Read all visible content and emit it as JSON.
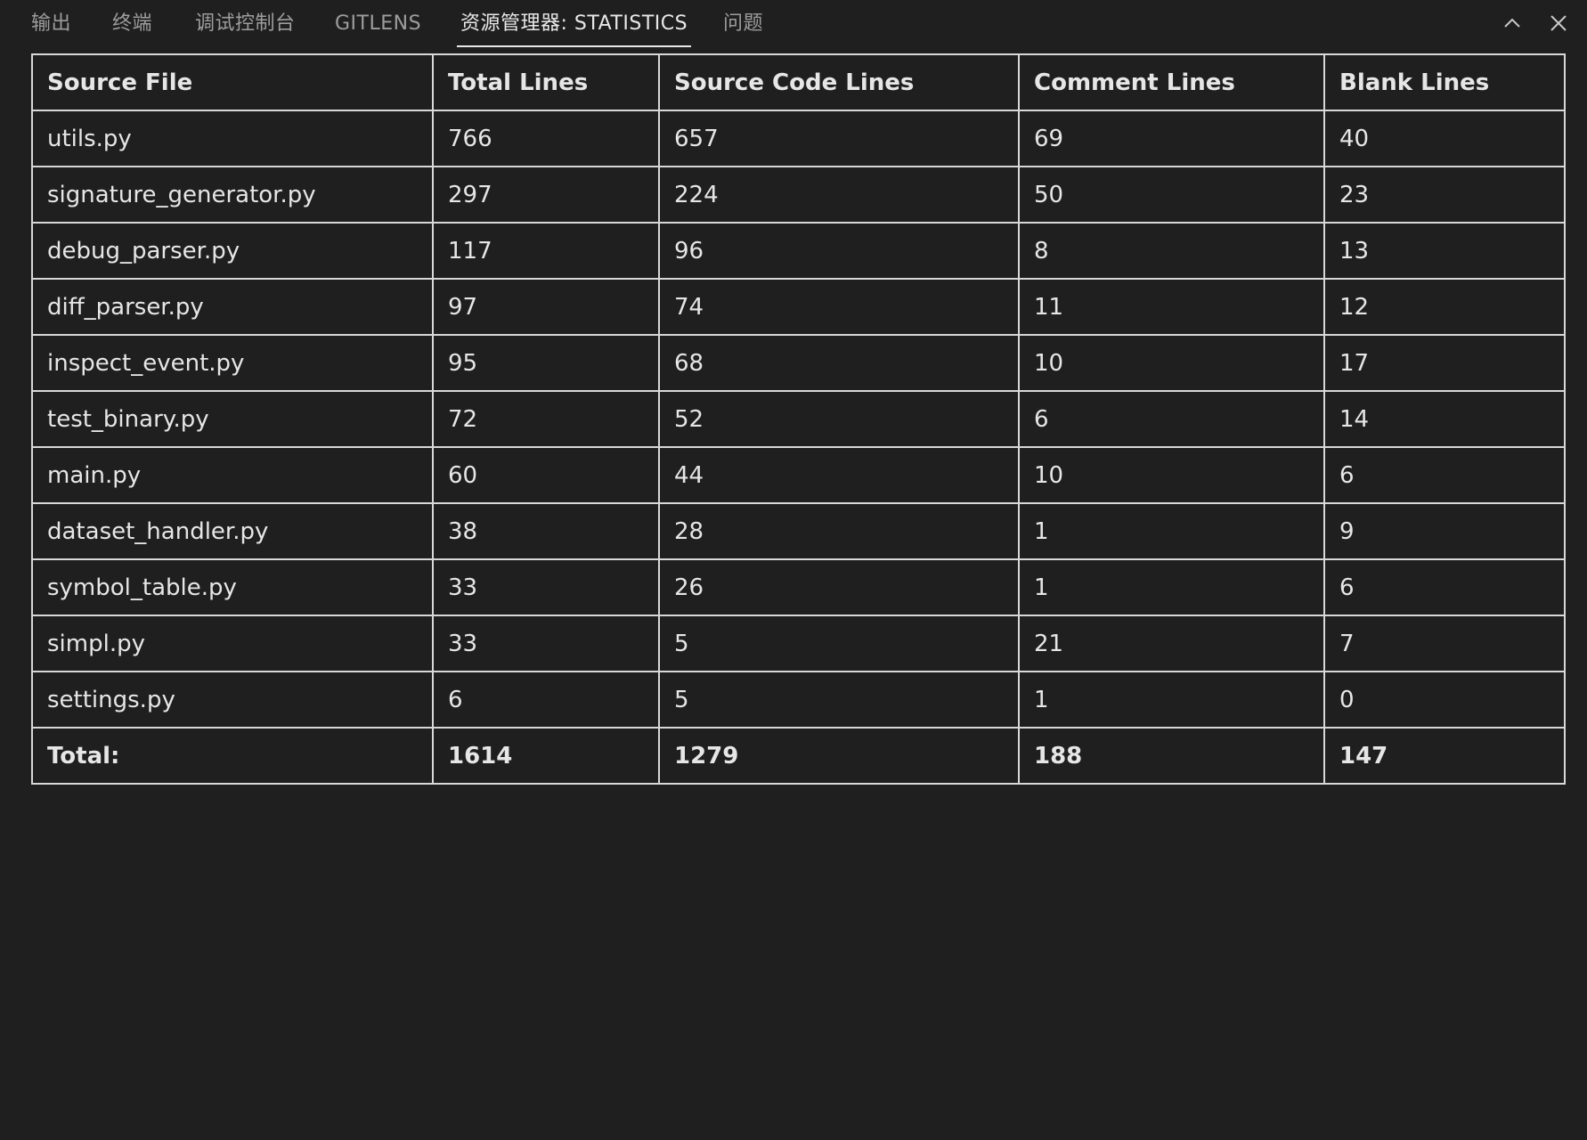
{
  "tabs": [
    {
      "label": "输出",
      "active": false
    },
    {
      "label": "终端",
      "active": false
    },
    {
      "label": "调试控制台",
      "active": false
    },
    {
      "label": "GITLENS",
      "active": false
    },
    {
      "label": "资源管理器: STATISTICS",
      "active": true
    },
    {
      "label": "问题",
      "active": false
    }
  ],
  "actions": {
    "collapse_icon": "chevron-up-icon",
    "close_icon": "close-icon"
  },
  "table": {
    "headers": [
      "Source File",
      "Total Lines",
      "Source Code Lines",
      "Comment Lines",
      "Blank Lines"
    ],
    "rows": [
      [
        "utils.py",
        "766",
        "657",
        "69",
        "40"
      ],
      [
        "signature_generator.py",
        "297",
        "224",
        "50",
        "23"
      ],
      [
        "debug_parser.py",
        "117",
        "96",
        "8",
        "13"
      ],
      [
        "diff_parser.py",
        "97",
        "74",
        "11",
        "12"
      ],
      [
        "inspect_event.py",
        "95",
        "68",
        "10",
        "17"
      ],
      [
        "test_binary.py",
        "72",
        "52",
        "6",
        "14"
      ],
      [
        "main.py",
        "60",
        "44",
        "10",
        "6"
      ],
      [
        "dataset_handler.py",
        "38",
        "28",
        "1",
        "9"
      ],
      [
        "symbol_table.py",
        "33",
        "26",
        "1",
        "6"
      ],
      [
        "simpl.py",
        "33",
        "5",
        "21",
        "7"
      ],
      [
        "settings.py",
        "6",
        "5",
        "1",
        "0"
      ]
    ],
    "total": [
      "Total:",
      "1614",
      "1279",
      "188",
      "147"
    ]
  },
  "colors": {
    "background": "#1f1f1f",
    "text": "#e6e6e6",
    "inactive_tab": "#9d9d9d",
    "border": "#d8d8d8"
  }
}
